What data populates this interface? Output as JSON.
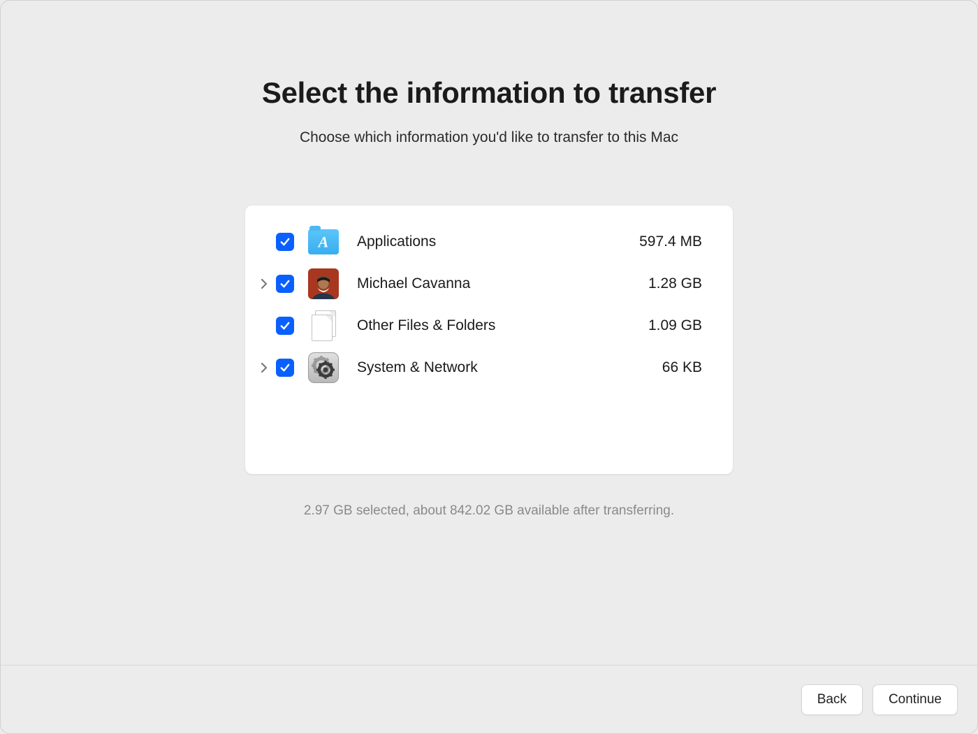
{
  "title": "Select the information to transfer",
  "subtitle": "Choose which information you'd like to transfer to this Mac",
  "items": [
    {
      "label": "Applications",
      "size": "597.4 MB",
      "expandable": false,
      "checked": true,
      "icon": "apps-folder"
    },
    {
      "label": "Michael Cavanna",
      "size": "1.28 GB",
      "expandable": true,
      "checked": true,
      "icon": "avatar"
    },
    {
      "label": "Other Files & Folders",
      "size": "1.09 GB",
      "expandable": false,
      "checked": true,
      "icon": "files"
    },
    {
      "label": "System & Network",
      "size": "66 KB",
      "expandable": true,
      "checked": true,
      "icon": "settings"
    }
  ],
  "status": "2.97 GB selected, about 842.02 GB available after transferring.",
  "buttons": {
    "back": "Back",
    "continue": "Continue"
  }
}
